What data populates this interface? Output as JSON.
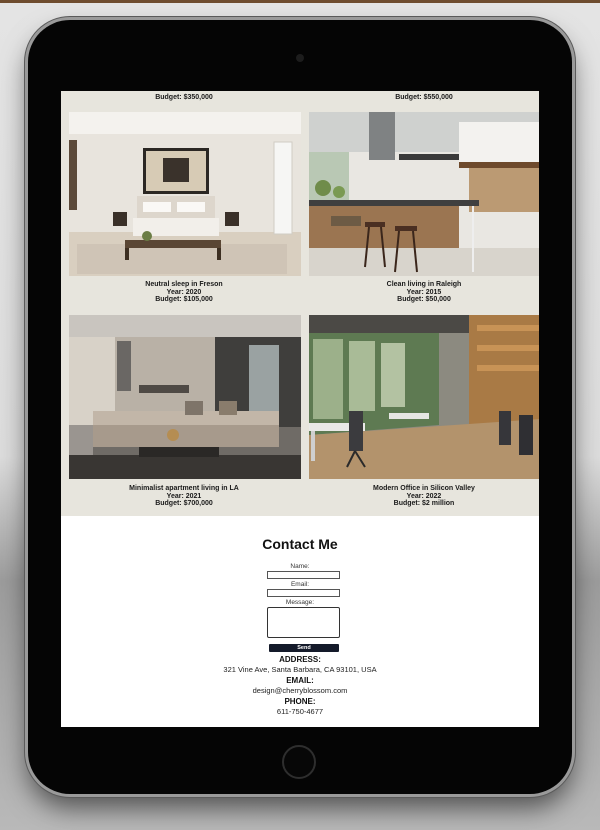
{
  "gallery": {
    "top_captions": {
      "left_budget": "Budget: $350,000",
      "right_budget": "Budget: $550,000"
    },
    "projects": [
      {
        "title": "Neutral sleep in Freson",
        "year": "Year: 2020",
        "budget": "Budget: $105,000"
      },
      {
        "title": "Clean living in Raleigh",
        "year": "Year: 2015",
        "budget": "Budget: $50,000"
      },
      {
        "title": "Minimalist apartment living in LA",
        "year": "Year: 2021",
        "budget": "Budget: $700,000"
      },
      {
        "title": "Modern Office in Silicon Valley",
        "year": "Year: 2022",
        "budget": "Budget: $2 million"
      }
    ]
  },
  "contact": {
    "title": "Contact Me",
    "name_label": "Name:",
    "email_label": "Email:",
    "message_label": "Message:",
    "send_label": "Send",
    "address_heading": "ADDRESS:",
    "address_value": "321 Vine Ave, Santa Barbara, CA 93101, USA",
    "email_heading": "EMAIL:",
    "email_value": "design@cherryblossom.com",
    "phone_heading": "PHONE:",
    "phone_value": "611-750-4677"
  },
  "colors": {
    "gallery_bg": "#e7e5dd",
    "send_button": "#141a2a",
    "device_frame": "#050505"
  }
}
